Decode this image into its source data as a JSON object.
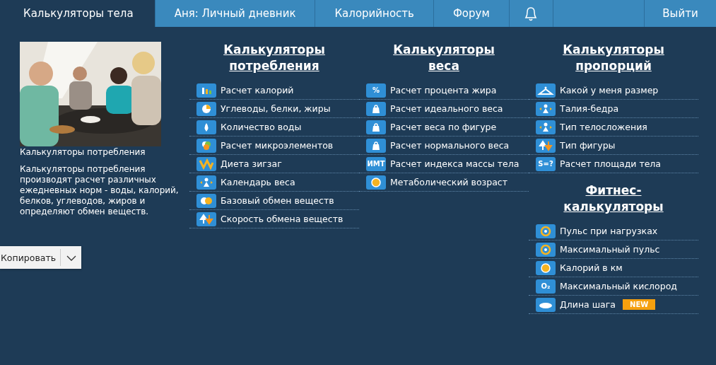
{
  "nav": {
    "tabs": [
      {
        "label": "Калькуляторы тела",
        "selected": true
      },
      {
        "label": "Аня: Личный дневник",
        "selected": false
      },
      {
        "label": "Калорийность",
        "selected": false
      },
      {
        "label": "Форум",
        "selected": false
      }
    ],
    "logout": "Выйти"
  },
  "feature": {
    "caption": "Калькуляторы потребления",
    "description": "Калькуляторы потребления производят расчет различных ежедневных норм - воды, калорий, белков, углеводов, жиров и определяют обмен веществ."
  },
  "columns": [
    {
      "sections": [
        {
          "title": "Калькуляторы потребления",
          "items": [
            {
              "label": "Расчет калорий"
            },
            {
              "label": "Углеводы, белки, жиры"
            },
            {
              "label": "Количество воды"
            },
            {
              "label": "Расчет микроэлементов"
            },
            {
              "label": "Диета зигзаг"
            },
            {
              "label": "Календарь веса"
            },
            {
              "label": "Базовый обмен веществ"
            },
            {
              "label": "Скорость обмена веществ"
            }
          ]
        }
      ]
    },
    {
      "sections": [
        {
          "title": "Калькуляторы веса",
          "items": [
            {
              "label": "Расчет процента жира",
              "icon_text": "%"
            },
            {
              "label": "Расчет идеального веса"
            },
            {
              "label": "Расчет веса по фигуре"
            },
            {
              "label": "Расчет нормального веса"
            },
            {
              "label": "Расчет индекса массы тела",
              "icon_text": "ИМТ"
            },
            {
              "label": "Метаболический возраст"
            }
          ]
        }
      ]
    },
    {
      "sections": [
        {
          "title": "Калькуляторы пропорций",
          "items": [
            {
              "label": "Какой у меня размер"
            },
            {
              "label": "Талия-бедра"
            },
            {
              "label": "Тип телосложения"
            },
            {
              "label": "Тип фигуры"
            },
            {
              "label": "Расчет площади тела",
              "icon_text": "S=?"
            }
          ]
        },
        {
          "title": "Фитнес-калькуляторы",
          "items": [
            {
              "label": "Пульс при нагрузках"
            },
            {
              "label": "Максимальный пульс"
            },
            {
              "label": "Калорий в км"
            },
            {
              "label": "Максимальный кислород",
              "icon_text": "O₂"
            },
            {
              "label": "Длина шага",
              "badge": "NEW"
            }
          ]
        }
      ]
    }
  ],
  "copy_popup": {
    "label": "Копировать"
  }
}
